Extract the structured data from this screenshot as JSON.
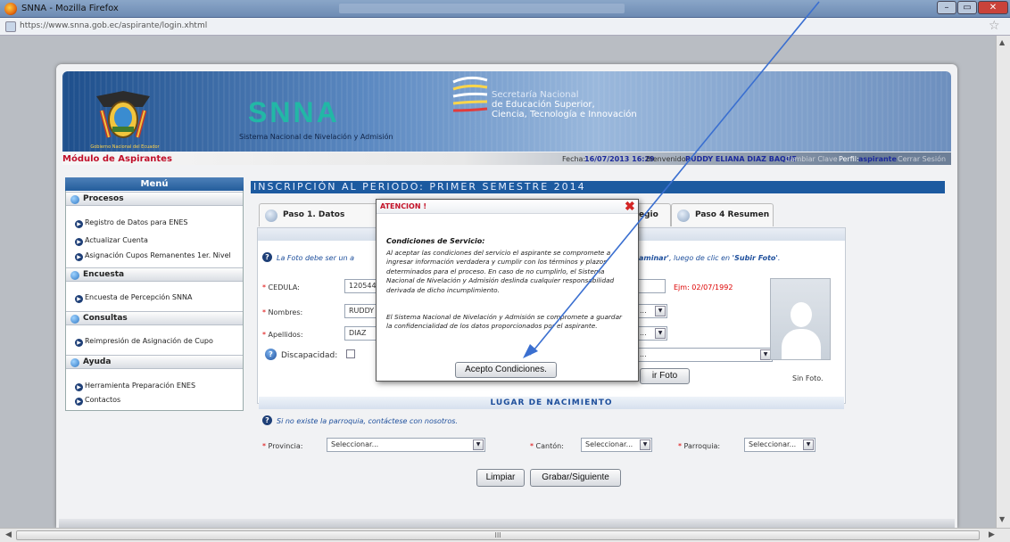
{
  "browser": {
    "window_title": "SNNA - Mozilla Firefox",
    "url": "https://www.snna.gob.ec/aspirante/login.xhtml",
    "url_domain": "snna.gob.ec",
    "scroll_center_glyph": "III"
  },
  "header": {
    "logo_text": "SNNA",
    "logo_subtitle": "Sistema Nacional de Nivelación y Admisión",
    "secretaria_line1": "Secretaría Nacional",
    "secretaria_line2": "de Educación Superior,",
    "secretaria_line3": "Ciencia, Tecnología e Innovación",
    "gov_caption": "Gobierno Nacional del Ecuador"
  },
  "infobar": {
    "module_title": "Módulo de Aspirantes",
    "fecha_label": "Fecha:",
    "fecha_value": "16/07/2013 16:29",
    "bienvenido_label": "Bienvenido:",
    "user_name": "RUDDY ELIANA DIAZ BAQUE",
    "cambiar_clave": "Cambiar Clave",
    "perfil_label": "Perfil:",
    "perfil_value": "aspirante",
    "cerrar_sesion": "Cerrar Sesión"
  },
  "menu": {
    "title": "Menú",
    "procesos": "Procesos",
    "registro": "Registro de Datos para ENES",
    "actualizar": "Actualizar Cuenta",
    "asignacion": "Asignación Cupos Remanentes 1er. Nivel",
    "encuesta_sec": "Encuesta",
    "encuesta_item": "Encuesta de Percepción SNNA",
    "consultas": "Consultas",
    "reimpresion": "Reimpresión de Asignación de Cupo",
    "ayuda": "Ayuda",
    "herramienta": "Herramienta Preparación ENES",
    "contactos": "Contactos"
  },
  "main": {
    "period_title": "INSCRIPCIÓN AL PERIODO: PRIMER SEMESTRE 2014",
    "tab1": "Paso 1. Datos Personal",
    "tab3_tail": "egio",
    "tab4": "Paso 4 Resumen",
    "photo_hint_start": "La Foto debe ser un a",
    "photo_hint_bold1": "aminar'",
    "photo_hint_mid": ", luego de clic en",
    "photo_hint_bold2": "'Subir Foto'",
    "cedula_label": "CEDULA:",
    "cedula_value": "120544",
    "fecha_hint": "Ejm: 02/07/1992",
    "nombres_label": "Nombres:",
    "nombres_value": "RUDDY",
    "apellidos_label": "Apellidos:",
    "apellidos_value": "DIAZ",
    "ellipsis": "...",
    "discapacidad_label": "Discapacidad:",
    "subir_foto_fragment": "ir Foto",
    "sin_foto": "Sin Foto.",
    "lugar_title": "LUGAR DE NACIMIENTO",
    "parroquia_hint": "Si no existe la parroquia, contáctese con nosotros.",
    "provincia_label": "Provincia:",
    "provincia_value": "Seleccionar...",
    "canton_label": "Cantón:",
    "canton_value": "Seleccionar...",
    "parroquia_label": "Parroquia:",
    "parroquia_value": "Seleccionar...",
    "limpiar": "Limpiar",
    "grabar": "Grabar/Siguiente"
  },
  "modal": {
    "title": "ATENCION !",
    "close": "✖",
    "subtitle": "Condiciones de Servicio:",
    "p1": "Al aceptar las condiciones del servicio el aspirante se compromete a ingresar información verdadera y cumplir con los términos y plazos determinados para el proceso. En caso de no cumplirlo, el Sistema Nacional de Nivelación y Admisión deslinda cualquier responsabilidad derivada de dicho incumplimiento.",
    "p2": "El Sistema Nacional de Nivelación y Admisión se compromete a guardar la confidencialidad de los datos proporcionados por el aspirante.",
    "accept": "Acepto Condiciones."
  },
  "colors": {
    "accent_blue": "#1c5aa0",
    "alert_red": "#c31228",
    "annotation_arrow": "#3a6fd0"
  },
  "icons": {
    "close": "close-icon",
    "help": "question-icon",
    "arrow": "arrow-right-icon"
  }
}
